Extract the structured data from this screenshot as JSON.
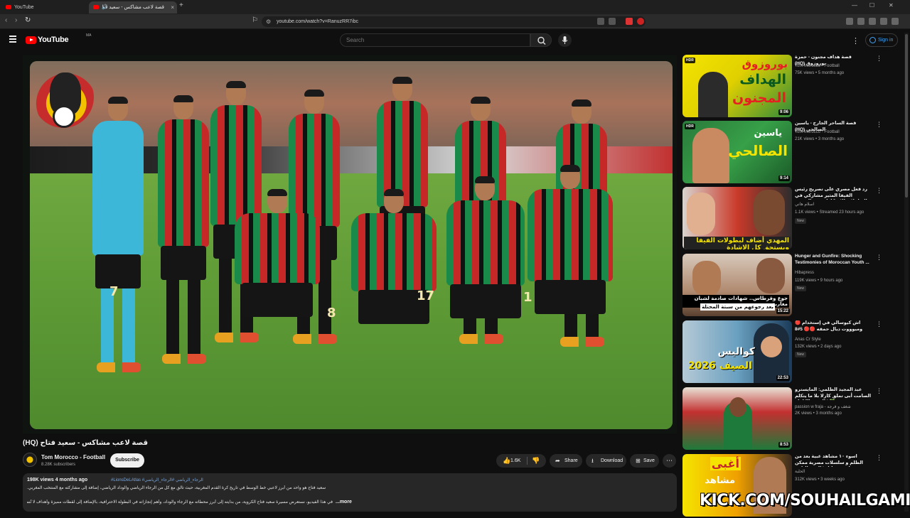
{
  "browser": {
    "tabs": [
      {
        "title": "YouTube"
      },
      {
        "title": "قصة لاعب مشاكس - سعيد فتا"
      }
    ],
    "url": "youtube.com/watch?v=RanuzRR7ibc"
  },
  "header": {
    "logo_text": "YouTube",
    "country_code": "MA",
    "search_placeholder": "Search",
    "signin_label": "Sign in"
  },
  "video": {
    "overlay_numbers": [
      "7",
      "8",
      "17",
      "1"
    ],
    "title": "قصة لاعب مشاكس - سعيد فتاح (HQ)",
    "channel": "Tom Morocco - Football",
    "subscribers": "8.28K subscribers",
    "subscribe_label": "Subscribe",
    "likes": "1.6K",
    "share_label": "Share",
    "download_label": "Download",
    "save_label": "Save",
    "views_time": "198K views  4 months ago",
    "hashtags": "#LionsDeLAtlas #الرجاء_الرياضي #الرجاء_الرياضي",
    "description_lines": [
      "سعيد فتاح هو واحد من أبرز لاعبي خط الوسط في تاريخ كرة القدم المغربية، حيث تألق مع كل من الرجاء الرياضي والوداد الرياضي، إضافة إلى مشاركته مع المنتخب المغربي.",
      "في هذا الفيديو، نستعرض مسيرة سعيد فتاح الكروية، من بدايته إلى أبرز محطاته مع الرجاء والوداد، وأهم إنجازاته في البطولة الاحترافية، بالإضافة إلى لقطات مميزة وأهداف لا تُنسى."
    ],
    "more_label": "...more"
  },
  "recommendations": [
    {
      "title": "قصة هداف مجنون - حمزة بوروزوق (HQ)",
      "channel": "Tom Morocco - Football",
      "meta": "75K views • 5 months ago",
      "duration": "9:06",
      "badge": "HDR",
      "thumb_text": [
        "بوروزوق",
        "الهداف",
        "المجنون"
      ],
      "new": ""
    },
    {
      "title": "قصة الساحر الجارح - ياسين الصالحي (HQ)",
      "channel": "Tom Morocco - Football",
      "meta": "21K views • 3 months ago",
      "duration": "9:14",
      "badge": "HDR",
      "thumb_text": [
        "ياسين",
        "الصالحي"
      ],
      "new": ""
    },
    {
      "title": "رد فعل مصري على تصريح رئيس الفيفا المثير مشاركي في البطولات الاحتكارات في المغرب",
      "channel": "اسلام هاني",
      "meta": "1.1K views • Streamed 23 hours ago",
      "duration": "",
      "badge": "",
      "thumb_text": [
        "المهدي أضاف لبطولات الفيفا ويستحق كل الاشادة"
      ],
      "new": "New"
    },
    {
      "title": "Hunger and Gunfire: Shocking Testimonies of Moroccan Youth ...",
      "channel": "Hibapress",
      "meta": "119K views • 9 hours ago",
      "duration": "15:22",
      "badge": "",
      "thumb_text": [
        "جوع وقرطاس.. شهادات صادمة لشبان مغاربة",
        "بعد رجوعهم من سبتة المحتلة"
      ],
      "new": "New"
    },
    {
      "title": "أش كيوسالي في إستخدام 🔴 وميوووت ديال حمقه 🔴🔴 5#8",
      "channel": "Anas Cr Style",
      "meta": "132K views • 2 days ago",
      "duration": "22:53",
      "badge": "",
      "thumb_text": [
        "كواليس",
        "الصيف 2026"
      ],
      "new": "New"
    },
    {
      "title": "عبد المجيد الظلمي: المايسترو الصامت أبى تملق كارلا بلا ما يتكلم 💚 | القصة الكاملة",
      "channel": "passion w fraja - شغف و فرجة",
      "meta": "2K views • 3 months ago",
      "duration": "8:53",
      "badge": "",
      "thumb_text": [],
      "new": ""
    },
    {
      "title": "أسوء ١٠ مشاهد غبية بعد من الظلم و سلسلات مصرية ممكن تشوفها في حياتك | الجزء الثاني",
      "channel": "الحلبة",
      "meta": "312K views • 3 weeks ago",
      "duration": "",
      "badge": "",
      "thumb_text": [
        "أغبى",
        "مشاهد"
      ],
      "new": ""
    }
  ],
  "watermark": "KICK.COM/SOUHAILGAMING",
  "colors": {
    "yt_red": "#ff0000",
    "link_blue": "#3ea6ff",
    "background": "#0f0f0f"
  }
}
